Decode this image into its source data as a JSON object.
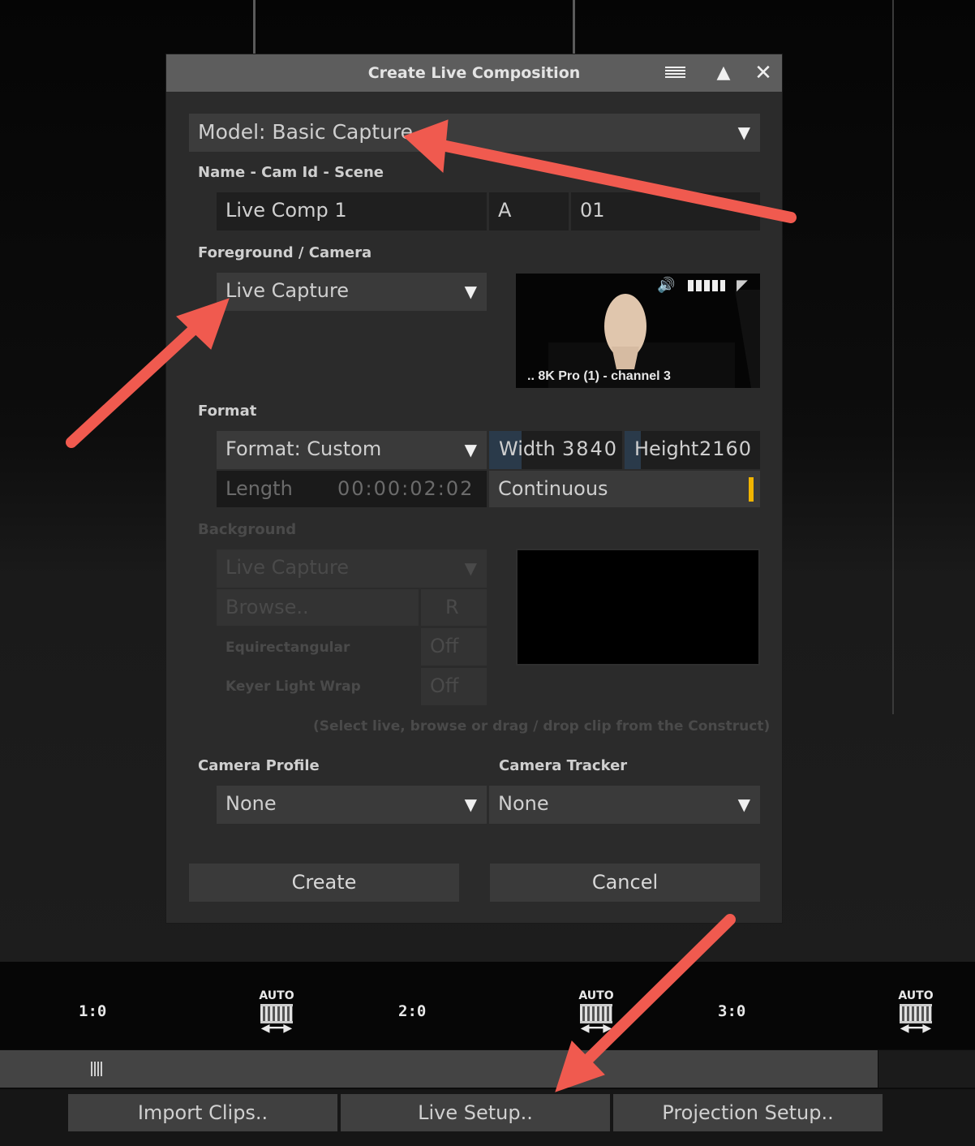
{
  "dialog": {
    "title": "Create Live Composition",
    "model_select": "Model: Basic Capture",
    "name_section_label": "Name - Cam Id - Scene",
    "name_value": "Live Comp 1",
    "cam_id_value": "A",
    "scene_value": "01",
    "foreground_label": "Foreground / Camera",
    "foreground_select": "Live Capture",
    "preview_caption": ".. 8K Pro (1) - channel 3",
    "format_label": "Format",
    "format_select": "Format: Custom",
    "width_label": "Width",
    "width_value": "3840",
    "height_label": "Height",
    "height_value": "2160",
    "length_label": "Length",
    "length_value": "00:00:02:02",
    "continuous_label": "Continuous",
    "background_label": "Background",
    "background_select": "Live Capture",
    "browse_label": "Browse..",
    "r_label": "R",
    "equirect_label": "Equirectangular",
    "equirect_value": "Off",
    "keyer_label": "Keyer Light Wrap",
    "keyer_value": "Off",
    "hint": "(Select live, browse or drag / drop clip from the Construct)",
    "camera_profile_label": "Camera Profile",
    "camera_profile_select": "None",
    "camera_tracker_label": "Camera Tracker",
    "camera_tracker_select": "None",
    "create_button": "Create",
    "cancel_button": "Cancel"
  },
  "timeline": {
    "markers": [
      "1:0",
      "2:0",
      "3:0"
    ],
    "auto_label": "AUTO"
  },
  "bottom_buttons": {
    "import": "Import Clips..",
    "live_setup": "Live Setup..",
    "projection": "Projection Setup.."
  },
  "icons": {
    "dropdown": "▼",
    "collapse": "▲",
    "close": "✕",
    "menu": "menu-lines-icon"
  },
  "colors": {
    "annotation_arrow": "#f05a4f",
    "continuous_marker": "#f0b400"
  }
}
